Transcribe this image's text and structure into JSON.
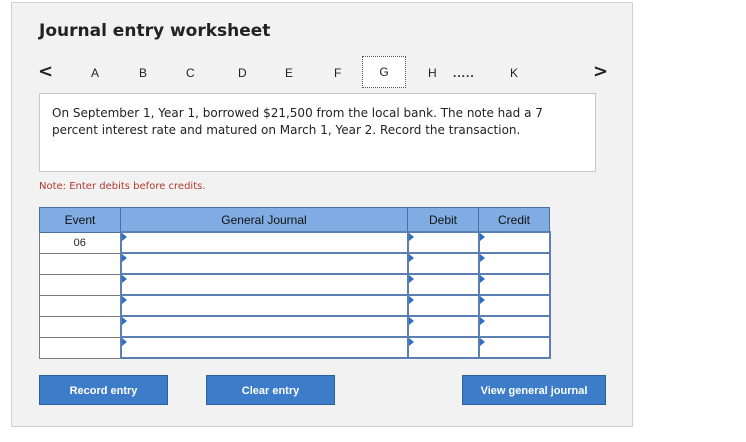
{
  "title": "Journal entry worksheet",
  "nav": {
    "prev_arrow": "<",
    "next_arrow": ">",
    "tabs": [
      "A",
      "B",
      "C",
      "D",
      "E",
      "F",
      "G",
      "H",
      "K"
    ],
    "active_tab": "G",
    "ellipsis": "....."
  },
  "question": "On September 1, Year 1, borrowed $21,500 from the local bank. The note had a 7 percent interest rate and matured on March 1, Year 2. Record the transaction.",
  "note": "Note: Enter debits before credits.",
  "table": {
    "headers": {
      "event": "Event",
      "general_journal": "General Journal",
      "debit": "Debit",
      "credit": "Credit"
    },
    "rows": [
      {
        "event": "06"
      },
      {
        "event": ""
      },
      {
        "event": ""
      },
      {
        "event": ""
      },
      {
        "event": ""
      },
      {
        "event": ""
      }
    ]
  },
  "buttons": {
    "record": "Record entry",
    "clear": "Clear entry",
    "view": "View general journal"
  }
}
